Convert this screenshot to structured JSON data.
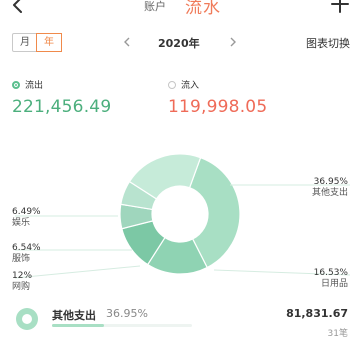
{
  "nav": {
    "tabs": [
      "账户",
      "流水"
    ]
  },
  "period": {
    "month_label": "月",
    "year_label": "年",
    "current": "2020年",
    "switch_label": "图表切换"
  },
  "summary": {
    "outflow": {
      "label": "流出",
      "amount": "221,456.49"
    },
    "inflow": {
      "label": "流入",
      "amount": "119,998.05"
    }
  },
  "colors": {
    "outflow": "#4caf7d",
    "inflow": "#ef6b58",
    "accent": "#f08a4b"
  },
  "chart_data": {
    "type": "pie",
    "series": [
      {
        "name": "其他支出",
        "value": 36.95,
        "color": "#a8dfc4"
      },
      {
        "name": "日用品",
        "value": 16.53,
        "color": "#8fd3b3"
      },
      {
        "name": "网购",
        "value": 12,
        "color": "#7cc8a5"
      },
      {
        "name": "服饰",
        "value": 6.54,
        "color": "#9fd6bd"
      },
      {
        "name": "娱乐",
        "value": 6.49,
        "color": "#b8e3cf"
      },
      {
        "name": "",
        "value": 21.49,
        "color": "#c6ebd9"
      }
    ],
    "labels": {
      "other": {
        "pct": "36.95%",
        "name": "其他支出"
      },
      "daily_goods": {
        "pct": "16.53%",
        "name": "日用品"
      },
      "online_shopping": {
        "pct": "12%",
        "name": "网购"
      },
      "clothing": {
        "pct": "6.54%",
        "name": "服饰"
      },
      "entertainment": {
        "pct": "6.49%",
        "name": "娱乐"
      }
    }
  },
  "list": [
    {
      "name": "其他支出",
      "percent": "36.95%",
      "amount": "81,831.67",
      "count": "31笔",
      "progress": 0.3695
    }
  ]
}
